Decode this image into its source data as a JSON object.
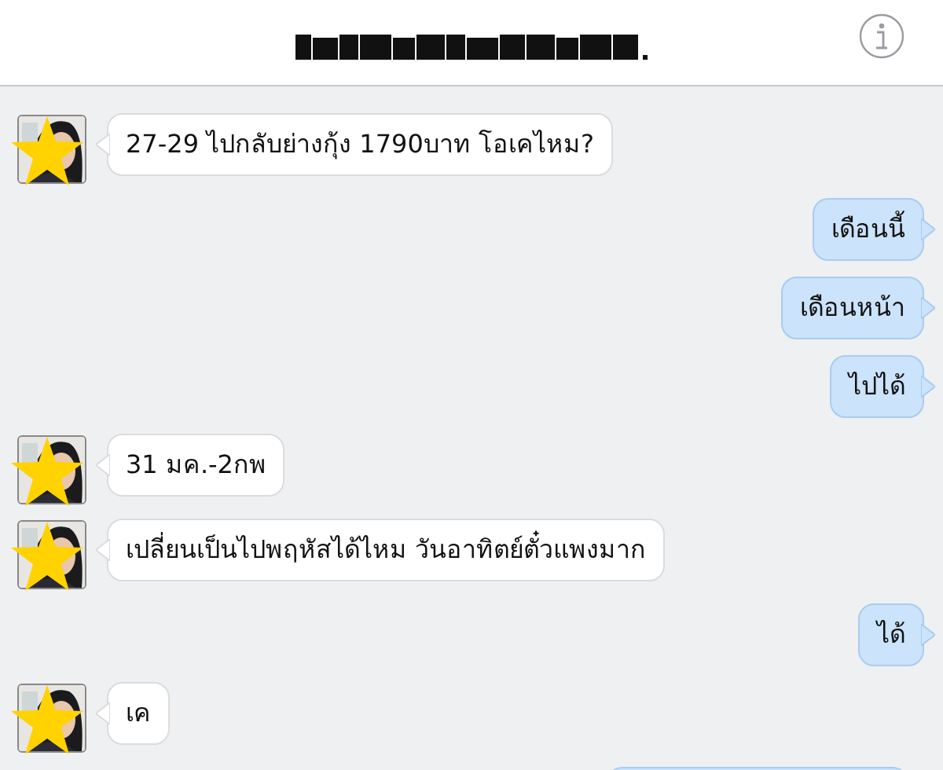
{
  "messages": [
    {
      "kind": "incoming",
      "text": "27-29 ไปกลับย่างกุ้ง 1790บาท โอเคไหม?"
    },
    {
      "kind": "outgoing",
      "text": "เดือนนี้"
    },
    {
      "kind": "outgoing",
      "text": "เดือนหน้า"
    },
    {
      "kind": "outgoing",
      "text": "ไปได้"
    },
    {
      "kind": "incoming",
      "text": "31 มค.-2กพ"
    },
    {
      "kind": "incoming",
      "text": "เปลี่ยนเป็นไปพฤหัสได้ไหม วันอาทิตย์ตั๋วแพงมาก"
    },
    {
      "kind": "outgoing",
      "text": "ได้"
    },
    {
      "kind": "incoming",
      "text": "เค"
    },
    {
      "kind": "partial"
    }
  ]
}
